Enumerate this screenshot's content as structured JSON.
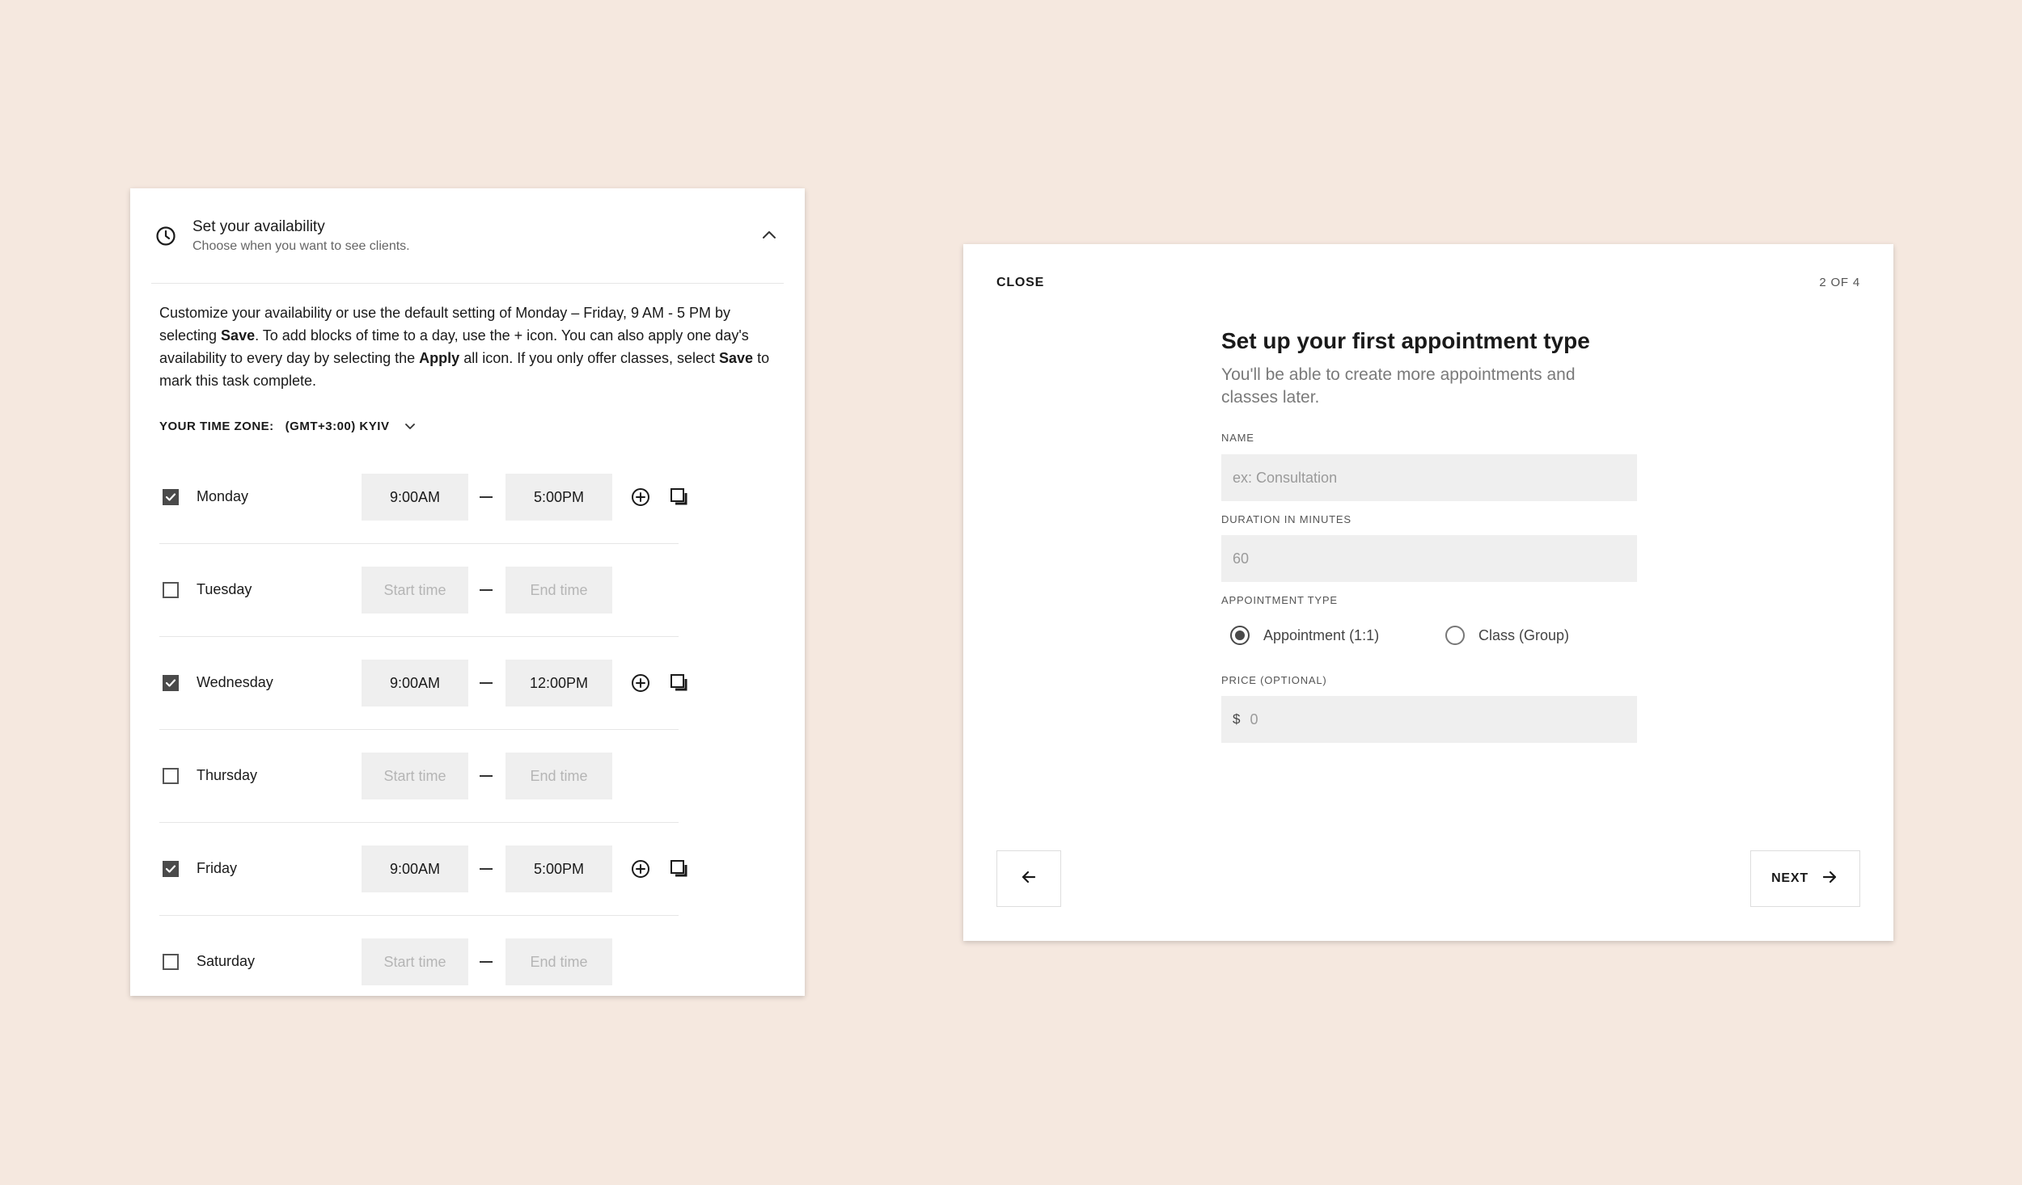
{
  "availability": {
    "header_title": "Set your availability",
    "header_subtitle": "Choose when you want to see clients.",
    "header_icon": "clock-icon",
    "collapse_icon": "chevron-up-icon",
    "instructions": {
      "t1": "Customize your availability or use the default setting of Monday – Friday, 9 AM - 5 PM by selecting ",
      "b1": "Save",
      "t2": ". To add blocks of time to a day, use the + icon. You can also apply one day's availability to every day by selecting the ",
      "b2": "Apply",
      "t3": " all icon. If you only offer classes, select ",
      "b3": "Save",
      "t4": " to mark this task complete."
    },
    "timezone_label": "YOUR TIME ZONE:",
    "timezone_value": "(GMT+3:00) KYIV",
    "days": [
      {
        "name": "Monday",
        "checked": true,
        "start": "9:00AM",
        "end": "5:00PM"
      },
      {
        "name": "Tuesday",
        "checked": false,
        "start": "Start time",
        "end": "End time"
      },
      {
        "name": "Wednesday",
        "checked": true,
        "start": "9:00AM",
        "end": "12:00PM"
      },
      {
        "name": "Thursday",
        "checked": false,
        "start": "Start time",
        "end": "End time"
      },
      {
        "name": "Friday",
        "checked": true,
        "start": "9:00AM",
        "end": "5:00PM"
      },
      {
        "name": "Saturday",
        "checked": false,
        "start": "Start time",
        "end": "End time"
      }
    ]
  },
  "appointment": {
    "close_label": "CLOSE",
    "step": "2 OF 4",
    "title": "Set up your first appointment type",
    "subtitle": "You'll be able to create more appointments and classes later.",
    "name_label": "NAME",
    "name_placeholder": "ex: Consultation",
    "duration_label": "DURATION IN MINUTES",
    "duration_placeholder": "60",
    "type_label": "APPOINTMENT TYPE",
    "type_options": [
      {
        "label": "Appointment (1:1)",
        "selected": true
      },
      {
        "label": "Class (Group)",
        "selected": false
      }
    ],
    "price_label": "PRICE (OPTIONAL)",
    "price_currency": "$",
    "price_placeholder": "0",
    "next_label": "NEXT",
    "back_icon": "arrow-left-icon",
    "next_icon": "arrow-right-icon"
  },
  "colors": {
    "background": "#f5e8df",
    "panel": "#ffffff",
    "input_fill": "#efefef",
    "checkbox_checked": "#4a4a4a"
  }
}
